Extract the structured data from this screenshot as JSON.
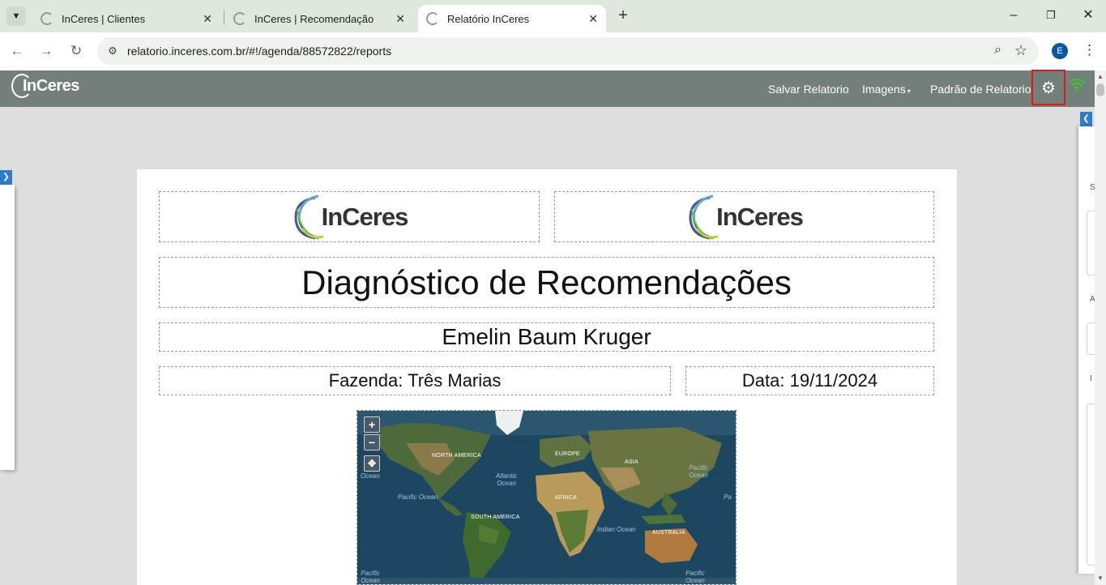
{
  "browser": {
    "tabs": [
      {
        "title": "InCeres | Clientes",
        "active": false
      },
      {
        "title": "InCeres | Recomendação",
        "active": false
      },
      {
        "title": "Relatório InCeres",
        "active": true
      }
    ],
    "url": "relatorio.inceres.com.br/#!/agenda/88572822/reports",
    "profile_initial": "E"
  },
  "app": {
    "logo_text": "InCeres",
    "nav": {
      "save_report": "Salvar Relatorio",
      "images": "Imagens",
      "report_default": "Padrão de Relatorio"
    },
    "accent_color": "#2f7bcb",
    "highlight_color": "#e0191d",
    "wifi_color": "#3fbf3a"
  },
  "report": {
    "logo_left": "InCeres",
    "logo_right": "InCeres",
    "title": "Diagnóstico de Recomendações",
    "client_name": "Emelin Baum Kruger",
    "farm": "Fazenda: Três Marias",
    "date": "Data: 19/11/2024"
  },
  "map": {
    "zoom_in": "+",
    "zoom_out": "−",
    "labels": {
      "north_america": "NORTH AMERICA",
      "south_america": "SOUTH AMERICA",
      "europe": "EUROPE",
      "asia": "ASIA",
      "africa": "AFRICA",
      "australia": "AUSTRALIA",
      "atlantic": "Atlantic Ocean",
      "pacific_left": "Pacific Ocean",
      "pacific_right": "Pacific Ocean",
      "indian": "Indian Ocean",
      "ocean_edge": "Ocean",
      "pacific_bottom_left": "Pacific Ocean",
      "pacific_bottom_right": "Pacific Ocean",
      "pa_edge": "Pa"
    }
  },
  "right_panel": {
    "chars": [
      "S",
      "A",
      "I"
    ]
  }
}
